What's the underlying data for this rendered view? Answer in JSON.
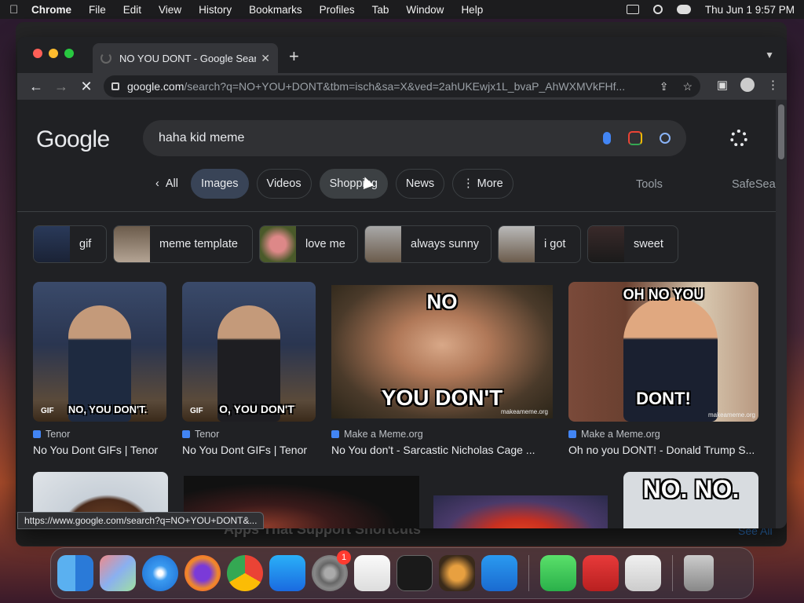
{
  "menubar": {
    "app": "Chrome",
    "items": [
      "File",
      "Edit",
      "View",
      "History",
      "Bookmarks",
      "Profiles",
      "Tab",
      "Window",
      "Help"
    ],
    "clock": "Thu Jun 1  9:57 PM"
  },
  "browser": {
    "tab_title": "NO YOU DONT - Google Searc",
    "url_host": "google.com",
    "url_path": "/search?q=NO+YOU+DONT&tbm=isch&sa=X&ved=2ahUKEwjx1L_bvaP_AhWXMVkFHf...",
    "status_url": "https://www.google.com/search?q=NO+YOU+DONT&..."
  },
  "google": {
    "logo": "Google",
    "query": "haha kid meme",
    "filters": {
      "all": "All",
      "images": "Images",
      "videos": "Videos",
      "shopping": "Shopping",
      "news": "News",
      "more": "More"
    },
    "tools": "Tools",
    "safesearch": "SafeSear",
    "related": [
      {
        "label": "gif"
      },
      {
        "label": "meme template"
      },
      {
        "label": "love me"
      },
      {
        "label": "always sunny"
      },
      {
        "label": "i got"
      },
      {
        "label": "sweet"
      }
    ],
    "results": [
      {
        "source": "Tenor",
        "title": "No You Dont GIFs | Tenor",
        "caption": "NO, YOU DON'T."
      },
      {
        "source": "Tenor",
        "title": "No You Dont GIFs | Tenor",
        "caption": "O, YOU DON'T"
      },
      {
        "source": "Make a Meme.org",
        "title": "No You don't - Sarcastic Nicholas Cage ...",
        "caption_top": "NO",
        "caption_bottom": "YOU DON'T",
        "watermark": "makeameme.org"
      },
      {
        "source": "Make a Meme.org",
        "title": "Oh no you DONT! - Donald Trump S...",
        "caption_top": "OH NO YOU",
        "caption_bottom": "DONT!",
        "watermark": "makeameme.org"
      }
    ],
    "row2_caption": "NO. NO."
  },
  "background_window": {
    "heading": "Apps That Support Shortcuts",
    "see_all": "See All"
  },
  "dock": {
    "settings_badge": "1"
  }
}
